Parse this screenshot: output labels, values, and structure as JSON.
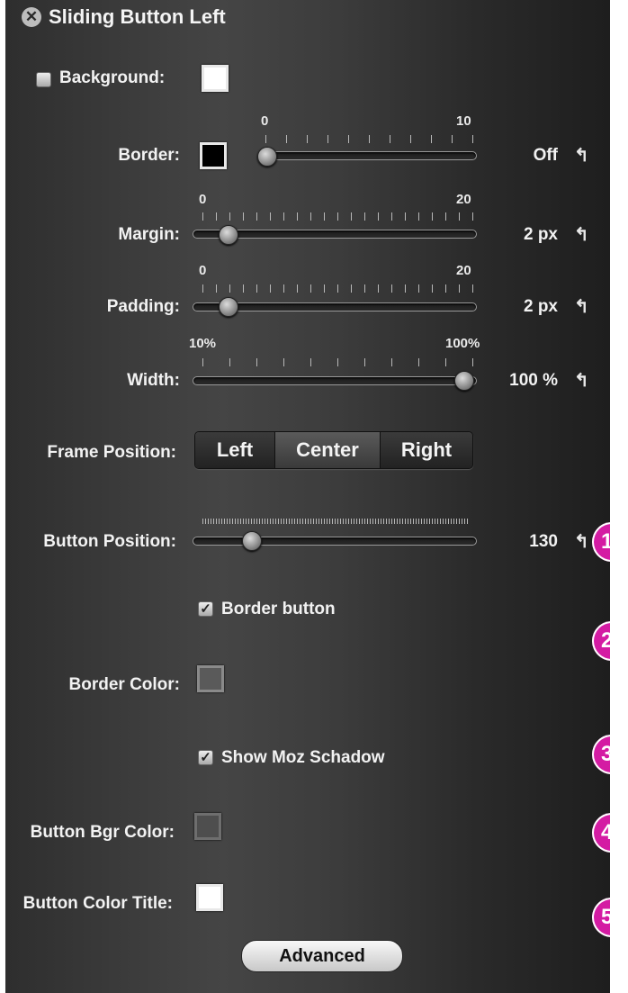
{
  "title": "Sliding Button Left",
  "background": {
    "label": "Background:",
    "checked": false,
    "swatch_color": "#ffffff"
  },
  "border": {
    "label": "Border:",
    "swatch_color": "#000000",
    "min": "0",
    "max": "10",
    "value_text": "Off",
    "fraction": 0.0
  },
  "margin": {
    "label": "Margin:",
    "min": "0",
    "max": "20",
    "value_text": "2 px",
    "fraction": 0.1
  },
  "padding": {
    "label": "Padding:",
    "min": "0",
    "max": "20",
    "value_text": "2 px",
    "fraction": 0.1
  },
  "width": {
    "label": "Width:",
    "min": "10%",
    "max": "100%",
    "value_text": "100 %",
    "fraction": 1.0
  },
  "frame_position": {
    "label": "Frame Position:",
    "options": [
      "Left",
      "Center",
      "Right"
    ],
    "selected": "Center"
  },
  "button_position": {
    "label": "Button Position:",
    "value_text": "130",
    "fraction": 0.2
  },
  "border_button": {
    "label": "Border button",
    "checked": true
  },
  "border_color": {
    "label": "Border Color:",
    "swatch_color": "#5a5a5a"
  },
  "show_moz_shadow": {
    "label": "Show Moz Schadow",
    "checked": true
  },
  "button_bgr_color": {
    "label": "Button Bgr Color:",
    "swatch_color": "#4e4e4e"
  },
  "button_color_title": {
    "label": "Button Color Title:",
    "swatch_color": "#ffffff"
  },
  "advanced_label": "Advanced",
  "reset_glyph": "↰",
  "badges": [
    "1",
    "2",
    "3",
    "4",
    "5"
  ]
}
